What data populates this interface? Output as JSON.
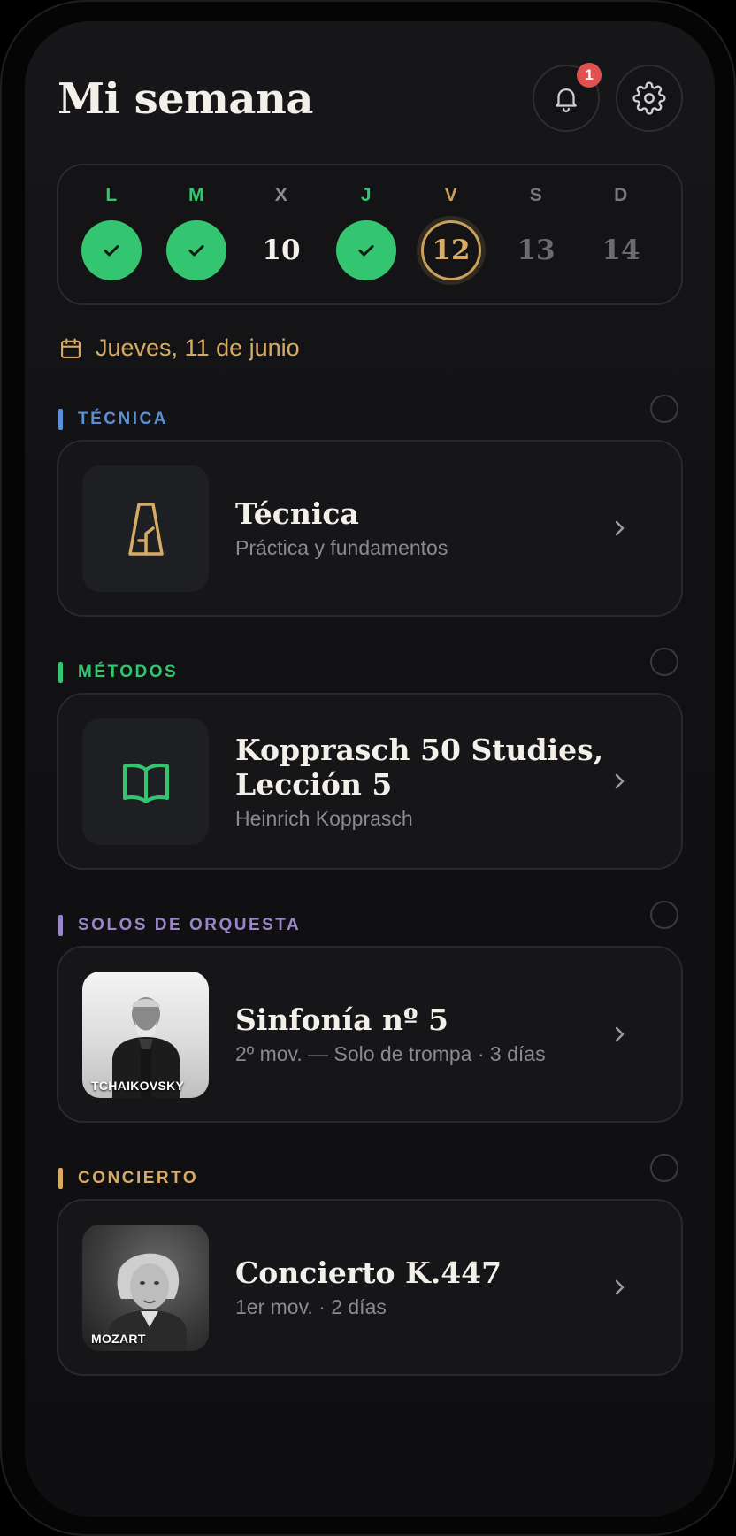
{
  "header": {
    "title": "Mi semana",
    "notification_count": "1"
  },
  "week": [
    {
      "letter": "L",
      "number": "",
      "state": "done"
    },
    {
      "letter": "M",
      "number": "",
      "state": "done"
    },
    {
      "letter": "X",
      "number": "10",
      "state": "missed"
    },
    {
      "letter": "J",
      "number": "",
      "state": "done"
    },
    {
      "letter": "V",
      "number": "12",
      "state": "today"
    },
    {
      "letter": "S",
      "number": "13",
      "state": "future"
    },
    {
      "letter": "D",
      "number": "14",
      "state": "future"
    }
  ],
  "selected_date": "Jueves, 11 de junio",
  "sections": [
    {
      "label": "TÉCNICA",
      "color": "#5b8fd6",
      "card": {
        "title": "Técnica",
        "subtitle": "Práctica y fundamentos",
        "icon": "metronome-icon"
      }
    },
    {
      "label": "MÉTODOS",
      "color": "#34c571",
      "card": {
        "title": "Kopprasch 50 Studies, Lección 5",
        "subtitle": "Heinrich Kopprasch",
        "icon": "open-book-icon"
      }
    },
    {
      "label": "SOLOS DE ORQUESTA",
      "color": "#9a86c8",
      "card": {
        "title": "Sinfonía nº 5",
        "subtitle": "2º mov. — Solo de trompa · 3 días",
        "portrait_caption": "TCHAIKOVSKY"
      }
    },
    {
      "label": "CONCIERTO",
      "color": "#d7ab63",
      "card": {
        "title": "Concierto K.447",
        "subtitle": "1er mov. · 2 días",
        "portrait_caption": "MOZART"
      }
    }
  ],
  "colors": {
    "accent_gold": "#c9a15c",
    "done_green": "#34c571",
    "background": "#111113"
  }
}
